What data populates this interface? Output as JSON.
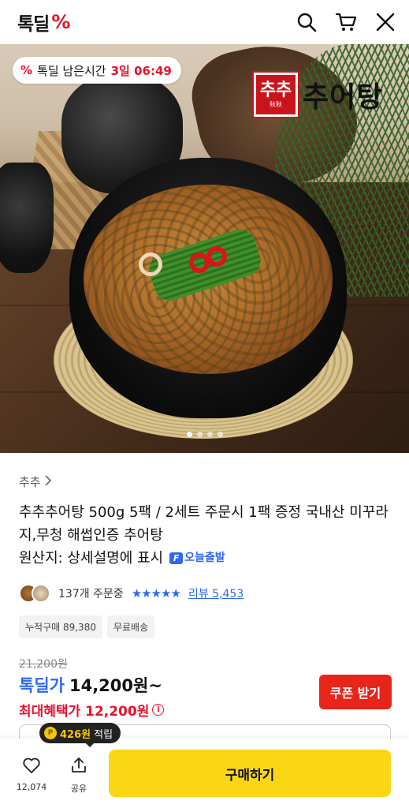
{
  "header": {
    "logo_text": "톡딜",
    "logo_mark": "%",
    "icons": [
      "search-icon",
      "cart-icon",
      "close-icon"
    ]
  },
  "hero": {
    "timer_label": "톡딜 남은시간",
    "timer_mark": "%",
    "timer_value": "3일 06:49",
    "brand_logo_text": "추추",
    "brand_logo_sub": "秋秋",
    "brand_name": "추어탕",
    "carousel_dots": 4,
    "carousel_active": 0
  },
  "product": {
    "brand_link": "추추",
    "title": "추추추어탕 500g 5팩 / 2세트 주문시 1팩 증정 국내산 미꾸라지,무청 해썹인증 추어탕",
    "origin": "원산지: 상세설명에 표시",
    "delivery_badge": "오늘출발",
    "delivery_icon_letter": "F",
    "orders_count": "137개 주문중",
    "stars": "★★★★★",
    "review_link": "리뷰 5,453",
    "chips": [
      "누적구매 89,380",
      "무료배송"
    ],
    "original_price": "21,200원",
    "deal_label": "톡딜가",
    "deal_price": "14,200원~",
    "max_benefit": "최대혜택가 12,200원",
    "coupon_button": "쿠폰 받기"
  },
  "bottom_bar": {
    "points_amount": "426원",
    "points_suffix": "적립",
    "points_coin": "P",
    "like_count": "12,074",
    "share_label": "공유",
    "buy_button": "구매하기"
  },
  "colors": {
    "accent_red": "#e8112d",
    "accent_blue": "#2f68f2",
    "buy_yellow": "#fbd615",
    "coupon_red": "#e8251b"
  }
}
